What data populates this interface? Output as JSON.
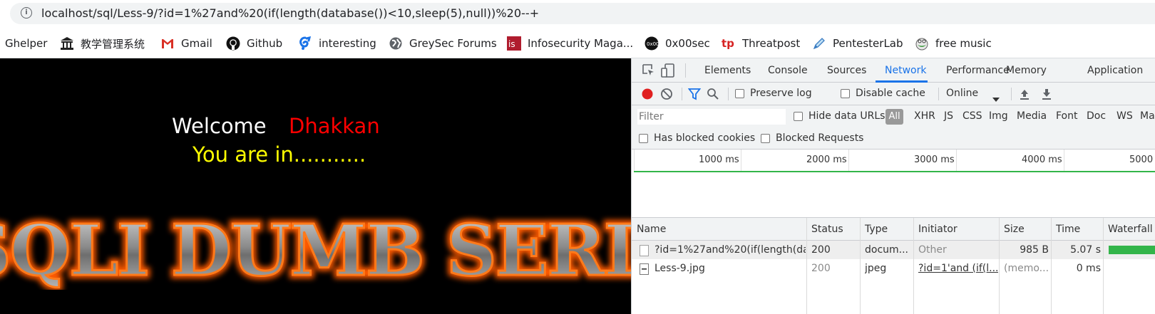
{
  "address_bar": {
    "url": "localhost/sql/Less-9/?id=1%27and%20(if(length(database())<10,sleep(5),null))%20--+"
  },
  "bookmarks": [
    {
      "label": "Ghelper",
      "icon": "none"
    },
    {
      "label": "教学管理系统",
      "icon": "building-icon"
    },
    {
      "label": "Gmail",
      "icon": "gmail-icon"
    },
    {
      "label": "Github",
      "icon": "github-icon"
    },
    {
      "label": "interesting",
      "icon": "swirl-icon"
    },
    {
      "label": "GreySec Forums",
      "icon": "globe-icon"
    },
    {
      "label": "Infosecurity Maga...",
      "icon": "is-logo-icon"
    },
    {
      "label": "0x00sec",
      "icon": "0x00sec-icon"
    },
    {
      "label": "Threatpost",
      "icon": "tp-logo-icon"
    },
    {
      "label": "PentesterLab",
      "icon": "pen-icon"
    },
    {
      "label": "free music",
      "icon": "frog-icon"
    }
  ],
  "page": {
    "welcome": "Welcome",
    "name": "Dhakkan",
    "status": "You are in...........",
    "banner": "SQLI DUMB SERIES",
    "colors": {
      "background": "#000000",
      "welcome": "#ffffff",
      "name": "#ff0000",
      "status": "#ffff00"
    }
  },
  "devtools": {
    "tabs": [
      "Elements",
      "Console",
      "Sources",
      "Network",
      "Performance",
      "Memory",
      "Application"
    ],
    "active_tab": "Network",
    "toolbar": {
      "preserve_log": "Preserve log",
      "disable_cache": "Disable cache",
      "throttle": "Online"
    },
    "filter": {
      "placeholder": "Filter",
      "hide_data_urls": "Hide data URLs",
      "types": [
        "All",
        "XHR",
        "JS",
        "CSS",
        "Img",
        "Media",
        "Font",
        "Doc",
        "WS",
        "Mar"
      ]
    },
    "blocked": {
      "has_blocked_cookies": "Has blocked cookies",
      "blocked_requests": "Blocked Requests"
    },
    "timeline_ticks": [
      "1000 ms",
      "2000 ms",
      "3000 ms",
      "4000 ms",
      "5000"
    ],
    "table": {
      "columns": [
        "Name",
        "Status",
        "Type",
        "Initiator",
        "Size",
        "Time",
        "Waterfall"
      ],
      "rows": [
        {
          "name": "?id=1%27and%20(if(length(da...",
          "status": "200",
          "type": "docum...",
          "initiator": "Other",
          "size": "985 B",
          "time": "5.07 s"
        },
        {
          "name": "Less-9.jpg",
          "status": "200",
          "type": "jpeg",
          "initiator": "?id=1'and (if(l...",
          "size": "(memo...",
          "time": "0 ms"
        }
      ]
    },
    "colors": {
      "accent": "#1a73e8",
      "record": "#e02020",
      "waterfall": "#33b54a"
    }
  }
}
